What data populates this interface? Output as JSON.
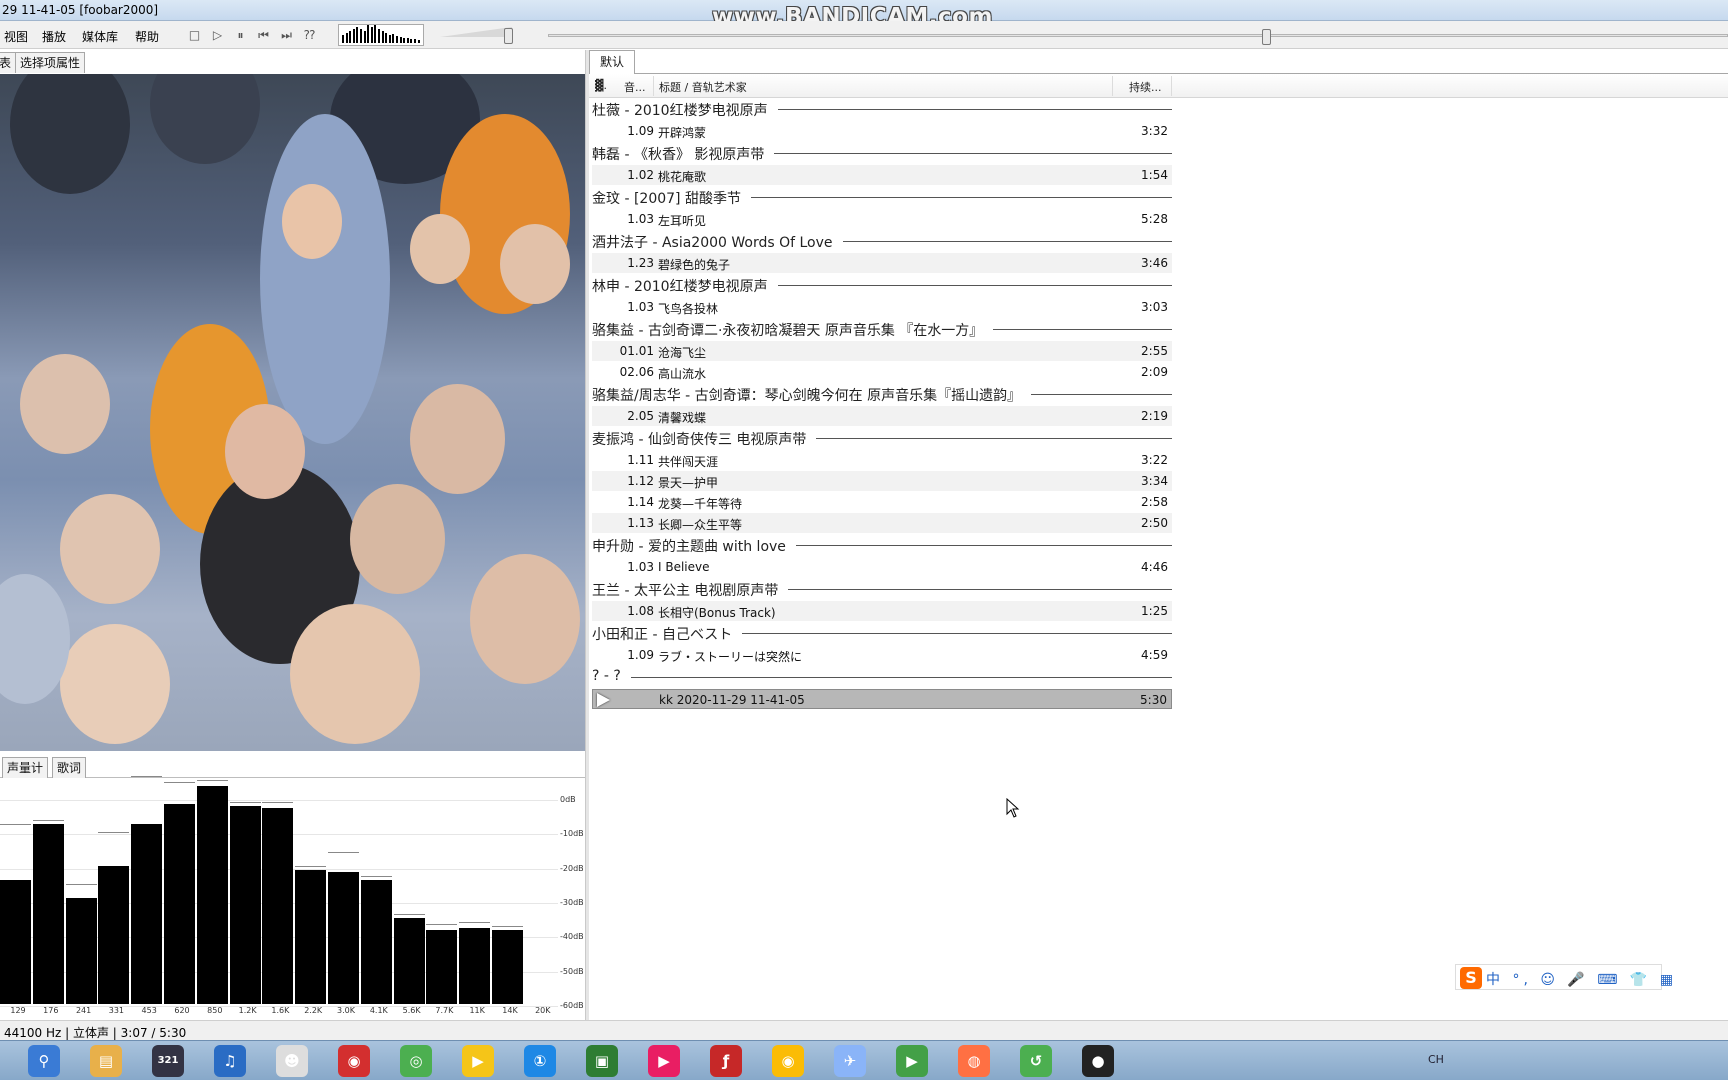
{
  "window": {
    "title": "29 11-41-05  [foobar2000]",
    "watermark": "www.BANDICAM.com"
  },
  "menu": {
    "items": [
      "视图",
      "播放",
      "媒体库",
      "帮助"
    ]
  },
  "left_panel": {
    "tabs": [
      "表",
      "选择项属性"
    ]
  },
  "bottom_panel": {
    "tabs": [
      "声量计",
      "歌词"
    ],
    "spectrum": {
      "db_labels": [
        "0dB",
        "-10dB",
        "-20dB",
        "-30dB",
        "-40dB",
        "-50dB",
        "-60dB"
      ],
      "freq_labels": [
        "129",
        "176",
        "241",
        "331",
        "453",
        "620",
        "850",
        "1.2K",
        "1.6K",
        "2.2K",
        "3.0K",
        "4.1K",
        "5.6K",
        "7.7K",
        "11K",
        "14K",
        "20K"
      ]
    }
  },
  "playlist": {
    "tab": "默认",
    "columns": {
      "indicator": "▓.",
      "number": "音...",
      "title": "标题 / 音轨艺术家",
      "duration": "持续..."
    },
    "groups": [
      {
        "header": "杜薇 - 2010红楼梦电视原声",
        "tracks": [
          {
            "num": "1.09",
            "title": "开辟鸿蒙",
            "duration": "3:32"
          }
        ]
      },
      {
        "header": "韩磊 - 《秋香》 影视原声带",
        "tracks": [
          {
            "num": "1.02",
            "title": "桃花庵歌",
            "duration": "1:54"
          }
        ]
      },
      {
        "header": "金玟 - [2007] 甜酸季节",
        "tracks": [
          {
            "num": "1.03",
            "title": "左耳听见",
            "duration": "5:28"
          }
        ]
      },
      {
        "header": "酒井法子 - Asia2000 Words Of Love",
        "tracks": [
          {
            "num": "1.23",
            "title": "碧绿色的兔子",
            "duration": "3:46"
          }
        ]
      },
      {
        "header": "林申 - 2010红楼梦电视原声",
        "tracks": [
          {
            "num": "1.03",
            "title": "飞鸟各投林",
            "duration": "3:03"
          }
        ]
      },
      {
        "header": "骆集益 - 古剑奇谭二·永夜初晗凝碧天 原声音乐集 『在水一方』",
        "tracks": [
          {
            "num": "01.01",
            "title": "沧海飞尘",
            "duration": "2:55"
          },
          {
            "num": "02.06",
            "title": "高山流水",
            "duration": "2:09"
          }
        ]
      },
      {
        "header": "骆集益/周志华 - 古剑奇谭：琴心剑魄今何在 原声音乐集『摇山遗韵』",
        "tracks": [
          {
            "num": "2.05",
            "title": "清馨戏蝶",
            "duration": "2:19"
          }
        ]
      },
      {
        "header": "麦振鸿 - 仙剑奇侠传三 电视原声带",
        "tracks": [
          {
            "num": "1.11",
            "title": "共伴闯天涯",
            "duration": "3:22"
          },
          {
            "num": "1.12",
            "title": "景天—护甲",
            "duration": "3:34"
          },
          {
            "num": "1.14",
            "title": "龙葵—千年等待",
            "duration": "2:58"
          },
          {
            "num": "1.13",
            "title": "长卿—众生平等",
            "duration": "2:50"
          }
        ]
      },
      {
        "header": "申升勋 - 爱的主题曲 with love",
        "tracks": [
          {
            "num": "1.03",
            "title": "I Believe",
            "duration": "4:46"
          }
        ]
      },
      {
        "header": "王兰 - 太平公主 电视剧原声带",
        "tracks": [
          {
            "num": "1.08",
            "title": "长相守(Bonus Track)",
            "duration": "1:25"
          }
        ]
      },
      {
        "header": "小田和正 - 自己ベスト",
        "tracks": [
          {
            "num": "1.09",
            "title": "ラブ・ストーリーは突然に",
            "duration": "4:59"
          }
        ]
      },
      {
        "header": "? - ?",
        "tracks": [
          {
            "num": "",
            "title": "kk 2020-11-29 11-41-05",
            "duration": "5:30",
            "playing": true
          }
        ]
      }
    ]
  },
  "status_bar": {
    "text": "44100 Hz | 立体声 | 3:07 / 5:30"
  },
  "ime": {
    "text": "中 °, ☺ 🎤 ⌨ 👕 ▦"
  },
  "taskbar": {
    "apps": [
      "search-icon",
      "folder-icon",
      "media-321-icon",
      "headphones-icon",
      "alien-icon",
      "netease-music-icon",
      "chrome-like-icon",
      "potplayer-icon",
      "360-icon",
      "iqiyi-icon",
      "youku-icon",
      "flash-icon",
      "chrome-icon",
      "bird-icon",
      "play-icon",
      "firefox-icon",
      "green-app-icon",
      "record-icon"
    ],
    "tray_text": "CH"
  },
  "colors": {
    "playing_row": "#b7b7b7",
    "spectrum_bar": "#000000",
    "titlebar": "#c6d9ee"
  }
}
